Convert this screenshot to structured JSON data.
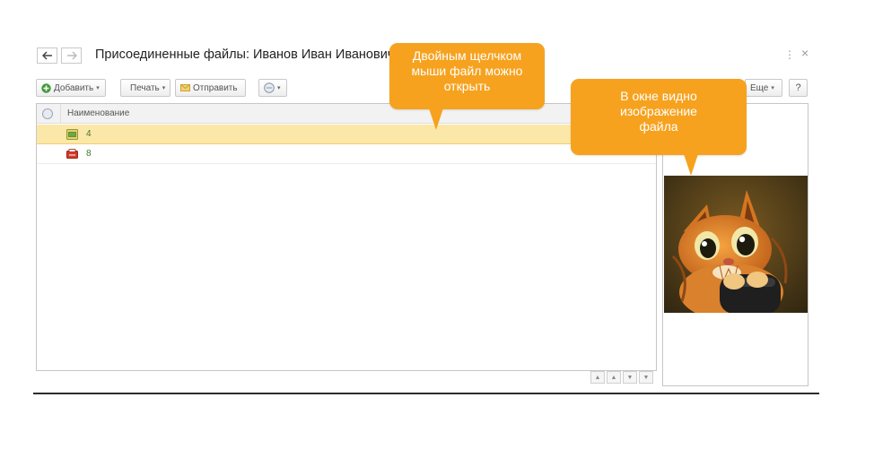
{
  "window": {
    "title": "Присоединенные файлы: Иванов Иван Иванович",
    "more_glyph": "⋮",
    "close_glyph": "×"
  },
  "toolbar": {
    "add_label": "Добавить",
    "print_label": "Печать",
    "send_label": "Отправить",
    "more_label": "Еще",
    "help_label": "?",
    "caret": "▾"
  },
  "list": {
    "column_name": "Наименование",
    "rows": [
      {
        "name": "4",
        "icon": "image-file-icon",
        "selected": true
      },
      {
        "name": "8",
        "icon": "pdf-file-icon",
        "selected": false
      }
    ]
  },
  "scroll_buttons": [
    "▲",
    "▲",
    "▼",
    "▼"
  ],
  "callouts": {
    "dblclick": {
      "line1": "Двойным щелчком",
      "line2": "мыши файл можно",
      "line3": "открыть"
    },
    "preview": {
      "line1": "В окне видно",
      "line2": "изображение",
      "line3": "файла"
    }
  },
  "colors": {
    "callout": "#f6a21f",
    "selected_row": "#fbe7a8",
    "add_icon": "#3e9a36",
    "file_name": "#3a7a2c"
  }
}
